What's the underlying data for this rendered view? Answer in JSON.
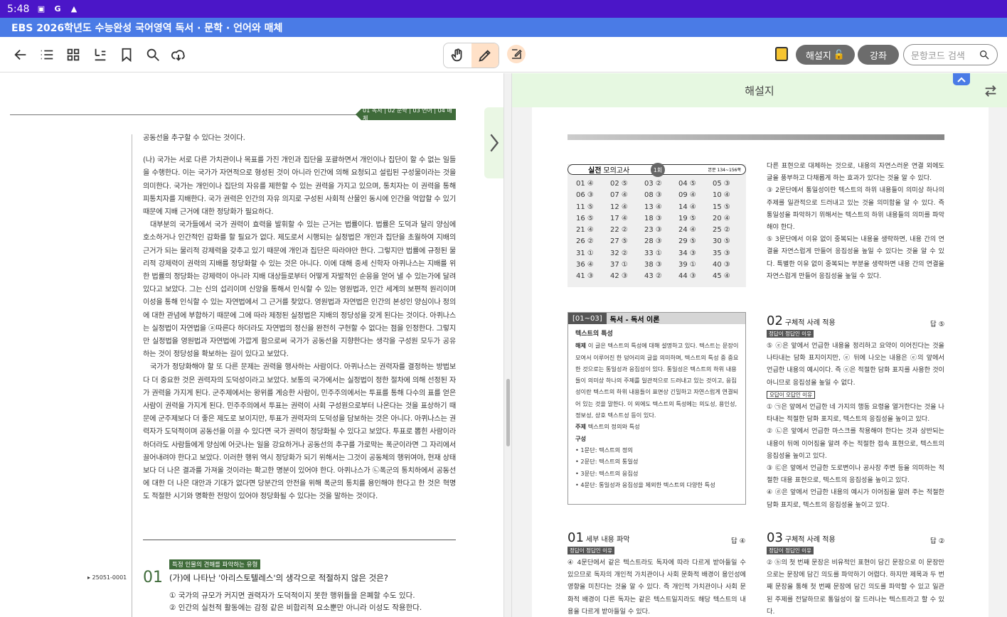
{
  "status_bar": {
    "time": "5:48",
    "icons": [
      "image-icon",
      "google-icon",
      "app-icon"
    ]
  },
  "title": "EBS 2026학년도 수능완성 국어영역 독서 · 문학 · 언어와 매체",
  "toolbar": {
    "right_buttons": {
      "explanation": "해설지",
      "lecture": "강좌",
      "search_placeholder": "문항코드 검색"
    }
  },
  "left": {
    "section_tabs": "01 독서 | 02 문학 | 03 언어 | 04 매체",
    "passage": [
      "공동선을 추구할 수 있다는 것이다.",
      "(나) 국가는 서로 다른 가치관이나 목표를 가진 개인과 집단을 포괄하면서 개인이나 집단이 할 수 없는 일들을 수행한다. 이는 국가가 자연적으로 형성된 것이 아니라 인간에 의해 요청되고 설립된 구성물이라는 것을 의미한다. 국가는 개인이나 집단의 자유를 제한할 수 있는 권력을 가지고 있으며, 통치자는 이 권력을 통해 피통치자를 지배한다. 국가 권력은 인간의 자유 의지로 구성된 사회적 산물인 동시에 인간을 억압할 수 있기 때문에 지배 근거에 대한 정당화가 필요하다.",
      "대부분의 국가들에서 국가 권력이 효력을 발휘할 수 있는 근거는 법률이다. 법률은 도덕과 달리 양심에 호소하거나 인간적인 감화를 할 필요가 없다. 제도로서 시행되는 실정법은 개인과 집단을 초월하여 지배의 근거가 되는 물리적 강제력을 갖추고 있기 때문에 개인과 집단은 따라야만 한다. 그렇지만 법률에 규정된 물리적 강제력이 권력의 지배를 정당화할 수 있는 것은 아니다. 이에 대해 중세 신학자 아퀴나스는 지배를 위한 법률의 정당화는 강제력이 아니라 지배 대상들로부터 어떻게 자발적인 순응을 얻어 낼 수 있는가에 달려 있다고 보았다. 그는 신의 섭리이며 신앙을 통해서 인식할 수 있는 영원법과, 인간 세계의 보편적 원리이며 이성을 통해 인식할 수 있는 자연법에서 그 근거를 찾았다. 영원법과 자연법은 인간의 본성인 양심이나 정의에 대한 관념에 부합하기 때문에 그에 따라 제정된 실정법은 지배의 정당성을 갖게 된다는 것이다. 아퀴나스는 실정법이 자연법을 ⓐ따른다 하더라도 자연법의 정신을 완전히 구현할 수 없다는 점을 인정한다. 그렇지만 실정법을 영원법과 자연법에 가깝게 함으로써 국가가 공동선을 지향한다는 생각을 구성원 모두가 공유하는 것이 정당성을 확보하는 길이 있다고 보았다.",
      "국가가 정당화해야 할 또 다른 문제는 권력을 행사하는 사람이다. 아퀴나스는 권력자를 결정하는 방법보다 더 중요한 것은 권력자의 도덕성이라고 보았다. 보통의 국가에서는 실정법이 정한 절차에 의해 선정된 자가 권력을 가지게 된다. 군주제에서는 왕위를 계승한 사람이, 민주주의에서는 투표를 통해 다수의 표를 얻은 사람이 권력을 가지게 된다. 민주주의에서 투표는 권력이 사회 구성원으로부터 나온다는 것을 표상하기 때문에 군주제보다 더 좋은 제도로 보이지만, 투표가 권력자의 도덕성을 담보하는 것은 아니다. 아퀴나스는 권력자가 도덕적이며 공동선을 이끌 수 있다면 국가 권력이 정당화될 수 있다고 보았다. 투표로 뽑힌 사람이라 하더라도 사람들에게 양심에 어긋나는 일을 강요하거나 공동선의 추구를 가로막는 폭군이라면 그 자리에서 끌어내려야 한다고 보았다. 이러한 행위 역시 정당화가 되기 위해서는 그것이 공동체의 행위여야, 현재 상태보다 더 나은 결과를 가져올 것이라는 확고한 명분이 있어야 한다. 아퀴나스가 ㉡폭군의 통치하에서 공동선에 대한 더 나은 대안과 기대가 없다면 당분간의 안전을 위해 폭군의 통치를 용인해야 한다고 한 것은 혁명도 적절한 시기와 명확한 전망이 있어야 정당화될 수 있다는 것을 말하는 것이다."
    ],
    "question": {
      "tag": "특정 인물의 견해를 파악하는 유형",
      "code": "▸ 25051-0001",
      "number": "01",
      "text": "(가)에 나타난 '아리스토텔레스'의 생각으로 적절하지 않은 것은?",
      "options": [
        "① 국가의 규모가 커지면 권력자가 도덕적이지 못한 행위들을 은폐할 수도 있다.",
        "② 인간의 실천적 활동에는 감정 같은 비합리적 요소뿐만 아니라 이성도 작용한다."
      ]
    }
  },
  "right": {
    "header": "해설지",
    "answer_table": {
      "title_bold": "실전",
      "title": "모의고사",
      "badge": "1회",
      "page_ref": "본문 134~156쪽",
      "answers": [
        "01 ④",
        "02 ⑤",
        "03 ②",
        "04 ⑤",
        "05 ③",
        "06 ③",
        "07 ④",
        "08 ③",
        "09 ④",
        "10 ④",
        "11 ⑤",
        "12 ④",
        "13 ④",
        "14 ④",
        "15 ⑤",
        "16 ⑤",
        "17 ④",
        "18 ③",
        "19 ⑤",
        "20 ④",
        "21 ④",
        "22 ②",
        "23 ③",
        "24 ④",
        "25 ②",
        "26 ②",
        "27 ⑤",
        "28 ③",
        "29 ⑤",
        "30 ⑤",
        "31 ①",
        "32 ②",
        "33 ①",
        "34 ③",
        "35 ③",
        "36 ④",
        "37 ①",
        "38 ③",
        "39 ①",
        "40 ③",
        "41 ③",
        "42 ③",
        "43 ②",
        "44 ③",
        "45 ④"
      ]
    },
    "concept": {
      "label": "[01~03]",
      "title": "독서 - 독서 이론",
      "heading": "텍스트의 특성",
      "explain_label": "해제",
      "explain": "이 글은 텍스트의 특성에 대해 설명하고 있다. 텍스트는 문장이 모여서 이루어진 한 덩어리의 글을 의미하며, 텍스트의 특성 중 중요한 것으로는 통일성과 응집성이 있다. 통일성은 텍스트의 하위 내용들이 의미상 하나의 주제를 일관적으로 드러내고 있는 것이고, 응집성이란 텍스트의 하위 내용들이 표면상 긴밀하고 자연스럽게 연결되어 있는 것을 말한다. 이 외에도 텍스트의 특성에는 의도성, 용인성, 정보성, 상호 텍스트성 등이 있다.",
      "theme_label": "주제",
      "theme": "텍스트의 정의와 특성",
      "structure_label": "구성",
      "structure": [
        "• 1문단: 텍스트의 정의",
        "• 2문단: 텍스트의 통일성",
        "• 3문단: 텍스트의 응집성",
        "• 4문단: 통일성과 응집성을 제외한 텍스트의 다양한 특성"
      ]
    },
    "q01": {
      "num": "01",
      "title": "세부 내용 파악",
      "answer": "답 ④",
      "tag": "정답이 정답인 이유",
      "text": "④ 4문단에서 같은 텍스트라도 독자에 따라 다르게 받아들일 수 있으므로 독자의 개인적 가치관이나 사회 문화적 배경이 용인성에 영향을 미친다는 것을 알 수 있다. 즉 개인적 가치관이나 사회 문화적 배경이 다른 독자는 같은 텍스트일지라도 해당 텍스트의 내용을 다르게 받아들일 수 있다."
    },
    "col2_top": [
      "다른 표현으로 대체하는 것으로, 내용의 자연스러운 연결 외에도 글을 풍부하고 다채롭게 하는 효과가 있다는 것을 알 수 있다.",
      "③ 2문단에서 통일성이란 텍스트의 하위 내용들이 의미상 하나의 주제를 일관적으로 드러내고 있는 것을 의미함을 알 수 있다. 즉 통일성을 파악하기 위해서는 텍스트의 하위 내용들의 의미를 파악해야 한다.",
      "⑤ 3문단에서 이유 없이 중복되는 내용을 생략하면, 내용 간의 연결을 자연스럽게 만들어 응집성을 높일 수 있다는 것을 알 수 있다. 특별한 이유 없이 중복되는 부분을 생략하면 내용 간의 연결을 자연스럽게 만들어 응집성을 높일 수 있다."
    ],
    "q02": {
      "num": "02",
      "title": "구체적 사례 적용",
      "answer": "답 ⑤",
      "tag_correct": "정답이 정답인 이유",
      "correct": "⑤ ⓔ은 앞에서 언급한 내용을 정리하고 요약이 이어진다는 것을 나타내는 담화 표지이지만, ⓔ 뒤에 나오는 내용은 ⓔ의 앞에서 언급한 내용의 예시이다. 즉 ⓔ은 적절한 담화 표지를 사용한 것이 아니므로 응집성을 높일 수 없다.",
      "tag_wrong": "오답이 오답인 이유",
      "wrong": [
        "① ㉠은 앞에서 언급한 네 가지의 행동 요령을 열거한다는 것을 나타내는 적절한 담화 표지로, 텍스트의 응집성을 높이고 있다.",
        "② ㉡은 앞에서 언급한 마스크를 착용해야 한다는 것과 상반되는 내용이 뒤에 이어짐을 알려 주는 적절한 접속 표현으로, 텍스트의 응집성을 높이고 있다.",
        "③ ㉢은 앞에서 언급한 도로변이나 공사장 주변 등을 의미하는 적절한 대용 표현으로, 텍스트의 응집성을 높이고 있다.",
        "④ ⓓ은 앞에서 언급한 내용의 예시가 이어짐을 알려 주는 적절한 담화 표지로, 텍스트의 응집성을 높이고 있다."
      ]
    },
    "q03": {
      "num": "03",
      "title": "구체적 사례 적용",
      "answer": "답 ②",
      "tag": "정답이 정답인 이유",
      "text": "② ⓑ의 첫 번째 문장은 비유적인 표현이 담긴 문장으로 이 문장만으로는 문장에 담긴 의도를 파악하기 어렵다. 하지만 제목과 두 번째 문장을 통해 첫 번째 문장에 담긴 의도를 파악할 수 있고 일관된 주제를 전달하므로 통일성이 잘 드러나는 텍스트라고 할 수 있다."
    }
  }
}
